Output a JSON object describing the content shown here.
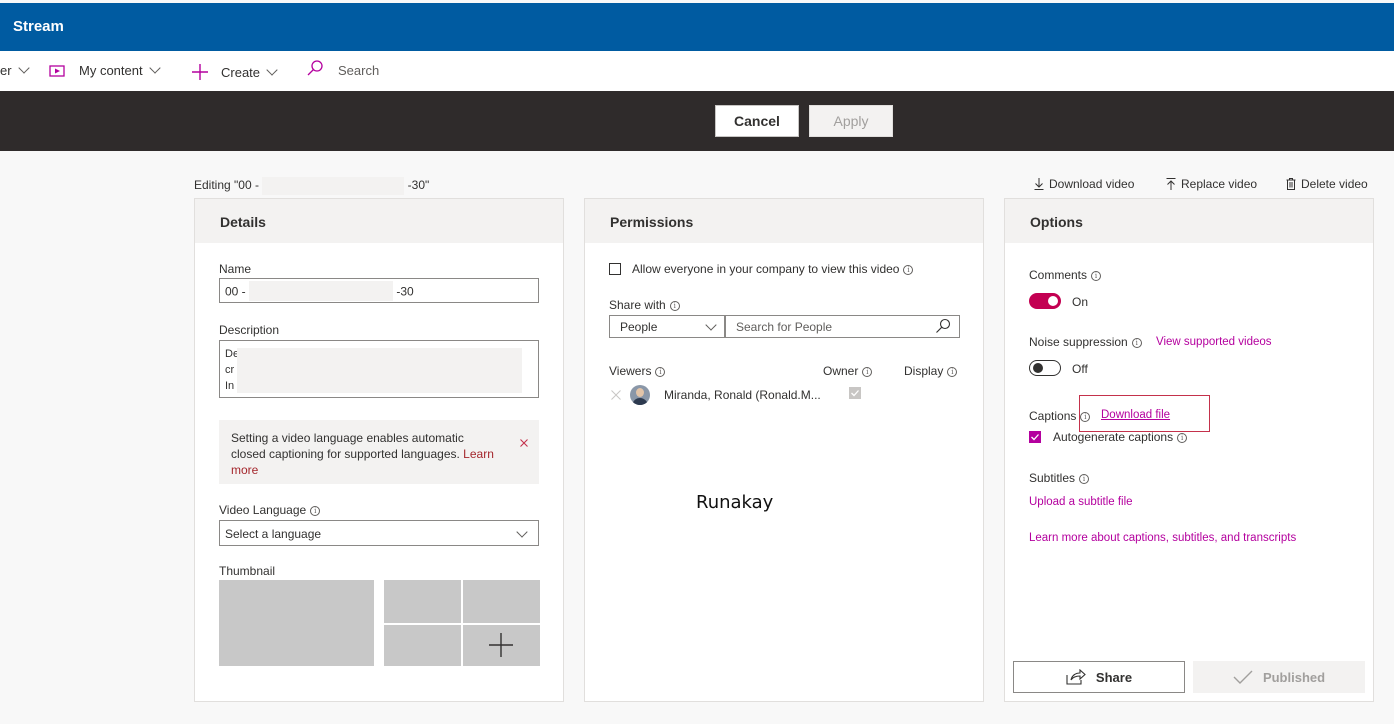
{
  "app": {
    "title": "Stream"
  },
  "nav": {
    "partial_label": "er",
    "my_content_label": "My content",
    "create_label": "Create",
    "search_placeholder": "Search"
  },
  "command_bar": {
    "cancel_label": "Cancel",
    "apply_label": "Apply"
  },
  "editing": {
    "prefix": "Editing \"00 -",
    "suffix": "-30\""
  },
  "video_actions": {
    "download_label": "Download video",
    "replace_label": "Replace video",
    "delete_label": "Delete video"
  },
  "details": {
    "title": "Details",
    "name_label": "Name",
    "name_prefix": "00 -",
    "name_suffix": "-30",
    "description_label": "Description",
    "description_lines": [
      "De",
      "cr",
      "In"
    ],
    "notice_text": "Setting a video language enables automatic closed captioning for supported languages.",
    "notice_link": "Learn more",
    "notice_link_line1": "Learn",
    "notice_link_line2": "more",
    "language_label": "Video Language",
    "language_value": "Select a language",
    "thumbnail_label": "Thumbnail"
  },
  "permissions": {
    "title": "Permissions",
    "allow_everyone_label": "Allow everyone in your company to view this video",
    "share_with_label": "Share with",
    "share_with_value": "People",
    "search_people_placeholder": "Search for People",
    "viewers_label": "Viewers",
    "owner_label": "Owner",
    "display_label": "Display",
    "viewers": [
      {
        "name": "Miranda, Ronald (Ronald.M...",
        "owner": true
      }
    ],
    "watermark": "Runakay"
  },
  "options": {
    "title": "Options",
    "comments_label": "Comments",
    "comments_state": "On",
    "noise_label": "Noise suppression",
    "noise_link": "View supported videos",
    "noise_state": "Off",
    "captions_label": "Captions",
    "captions_download_link": "Download file",
    "autogenerate_label": "Autogenerate captions",
    "subtitles_label": "Subtitles",
    "upload_subtitle_link": "Upload a subtitle file",
    "learn_more_link": "Learn more about captions, subtitles, and transcripts",
    "share_label": "Share",
    "published_label": "Published"
  },
  "colors": {
    "brand_blue": "#005ba1",
    "command_bar": "#2f2b2b",
    "accent_magenta": "#b4009e",
    "toggle_on": "#c30052",
    "highlight_box": "#c4314b"
  }
}
